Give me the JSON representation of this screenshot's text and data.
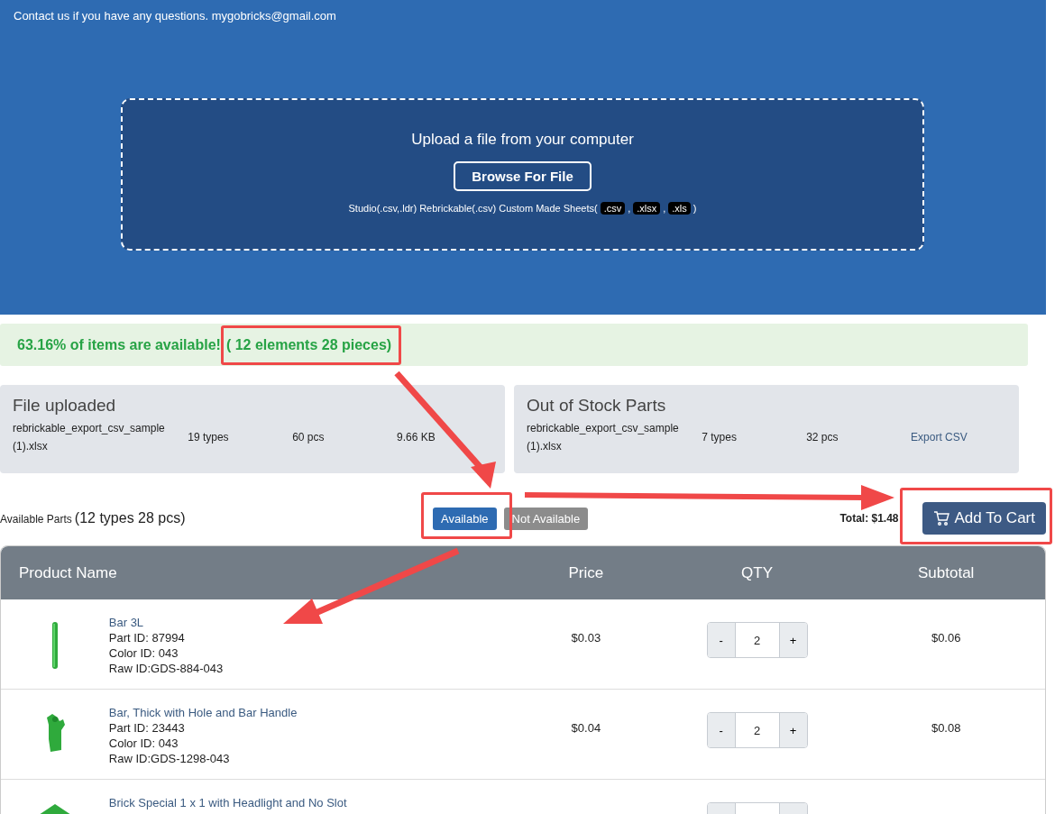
{
  "header": {
    "contact": "Contact us if you have any questions. mygobricks@gmail.com"
  },
  "upload": {
    "title": "Upload a file from your computer",
    "button": "Browse For File",
    "note_prefix": "Studio(.csv,.ldr) Rebrickable(.csv) Custom Made Sheets(",
    "formats": [
      ".csv",
      ".xlsx",
      ".xls"
    ],
    "separator": ",",
    "note_suffix": ")"
  },
  "availability": {
    "message": "63.16% of items are available!",
    "counts": "( 12 elements 28 pieces)"
  },
  "cards": [
    {
      "title": "File uploaded",
      "file": "rebrickable_export_csv_sample (1).xlsx",
      "types": "19 types",
      "pcs": "60 pcs",
      "size": "9.66 KB"
    },
    {
      "title": "Out of Stock Parts",
      "file": "rebrickable_export_csv_sample (1).xlsx",
      "types": "7 types",
      "pcs": "32 pcs",
      "export_link": "Export CSV"
    }
  ],
  "toolbar": {
    "label": "Available Parts",
    "count": "(12 types 28 pcs)",
    "filters": [
      {
        "label": "Available",
        "selected": true
      },
      {
        "label": "Not Available",
        "selected": false
      }
    ],
    "total": "Total: $1.48",
    "cart_button": "Add To Cart"
  },
  "table": {
    "columns": [
      "Product Name",
      "Price",
      "QTY",
      "Subtotal"
    ],
    "decrease": "-",
    "increase": "+",
    "rows": [
      {
        "kind": "bar",
        "name": "Bar 3L",
        "part_id": "Part ID: 87994",
        "color_id": "Color ID: 043",
        "raw_id": "Raw ID:GDS-884-043",
        "price": "$0.03",
        "qty": "2",
        "subtotal": "$0.06"
      },
      {
        "kind": "handle",
        "name": "Bar, Thick with Hole and Bar Handle",
        "part_id": "Part ID: 23443",
        "color_id": "Color ID: 043",
        "raw_id": "Raw ID:GDS-1298-043",
        "price": "$0.04",
        "qty": "2",
        "subtotal": "$0.08"
      },
      {
        "kind": "brick",
        "name": "Brick Special 1 x 1 with Headlight and No Slot"
      }
    ]
  }
}
